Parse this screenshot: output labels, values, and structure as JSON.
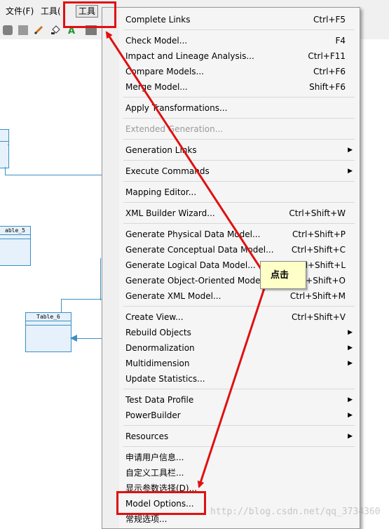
{
  "menubar": {
    "file": "文件(F)",
    "tools_partial": "工具(",
    "tools_active": "工具"
  },
  "canvas": {
    "table5": "able_5",
    "table6": "Table_6"
  },
  "menu": {
    "items": [
      {
        "label": "Complete Links",
        "shortcut": "Ctrl+F5"
      },
      {
        "label": "Check Model...",
        "shortcut": "F4"
      },
      {
        "label": "Impact and Lineage Analysis...",
        "shortcut": "Ctrl+F11"
      },
      {
        "label": "Compare Models...",
        "shortcut": "Ctrl+F6"
      },
      {
        "label": "Merge Model...",
        "shortcut": "Shift+F6"
      },
      {
        "label": "Apply Transformations...",
        "shortcut": ""
      },
      {
        "label": "Extended Generation...",
        "shortcut": ""
      },
      {
        "label": "Generation Links",
        "shortcut": ""
      },
      {
        "label": "Execute Commands",
        "shortcut": ""
      },
      {
        "label": "Mapping Editor...",
        "shortcut": ""
      },
      {
        "label": "XML Builder Wizard...",
        "shortcut": "Ctrl+Shift+W"
      },
      {
        "label": "Generate Physical Data Model...",
        "shortcut": "Ctrl+Shift+P"
      },
      {
        "label": "Generate Conceptual Data Model...",
        "shortcut": "Ctrl+Shift+C"
      },
      {
        "label": "Generate Logical Data Model...",
        "shortcut": "Ctrl+Shift+L"
      },
      {
        "label": "Generate Object-Oriented Model...",
        "shortcut": "Ctrl+Shift+O"
      },
      {
        "label": "Generate XML Model...",
        "shortcut": "Ctrl+Shift+M"
      },
      {
        "label": "Create View...",
        "shortcut": "Ctrl+Shift+V"
      },
      {
        "label": "Rebuild Objects",
        "shortcut": ""
      },
      {
        "label": "Denormalization",
        "shortcut": ""
      },
      {
        "label": "Multidimension",
        "shortcut": ""
      },
      {
        "label": "Update Statistics...",
        "shortcut": ""
      },
      {
        "label": "Test Data Profile",
        "shortcut": ""
      },
      {
        "label": "PowerBuilder",
        "shortcut": ""
      },
      {
        "label": "Resources",
        "shortcut": ""
      },
      {
        "label": "申请用户信息...",
        "shortcut": ""
      },
      {
        "label": "自定义工具栏...",
        "shortcut": ""
      },
      {
        "label": "显示参数选择(D)...",
        "shortcut": ""
      },
      {
        "label": "Model Options...",
        "shortcut": ""
      },
      {
        "label": "常规选项...",
        "shortcut": ""
      }
    ]
  },
  "callout": "点击",
  "watermark": "http://blog.csdn.net/qq_3734360",
  "colors": {
    "highlight": "#e01010",
    "callout_bg": "#ffffc8",
    "table_border": "#3b8fc4"
  }
}
